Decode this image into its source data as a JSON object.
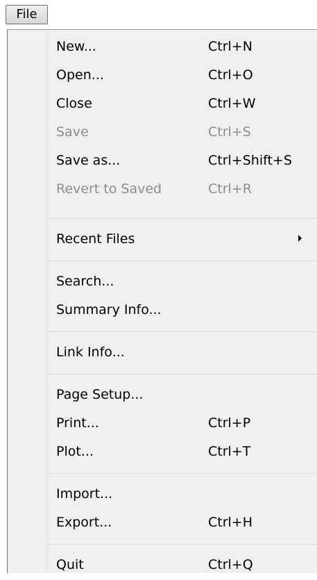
{
  "menubar": {
    "file_label": "File"
  },
  "menu": {
    "items": [
      {
        "label": "New...",
        "shortcut": "Ctrl+N"
      },
      {
        "label": "Open...",
        "shortcut": "Ctrl+O"
      },
      {
        "label": "Close",
        "shortcut": "Ctrl+W"
      },
      {
        "label": "Save",
        "shortcut": "Ctrl+S"
      },
      {
        "label": "Save as...",
        "shortcut": "Ctrl+Shift+S"
      },
      {
        "label": "Revert to Saved",
        "shortcut": "Ctrl+R"
      },
      {
        "label": "Recent Files"
      },
      {
        "label": "Search..."
      },
      {
        "label": "Summary Info..."
      },
      {
        "label": "Link Info..."
      },
      {
        "label": "Page Setup..."
      },
      {
        "label": "Print...",
        "shortcut": "Ctrl+P"
      },
      {
        "label": "Plot...",
        "shortcut": "Ctrl+T"
      },
      {
        "label": "Import..."
      },
      {
        "label": "Export...",
        "shortcut": "Ctrl+H"
      },
      {
        "label": "Quit",
        "shortcut": "Ctrl+Q"
      }
    ]
  }
}
